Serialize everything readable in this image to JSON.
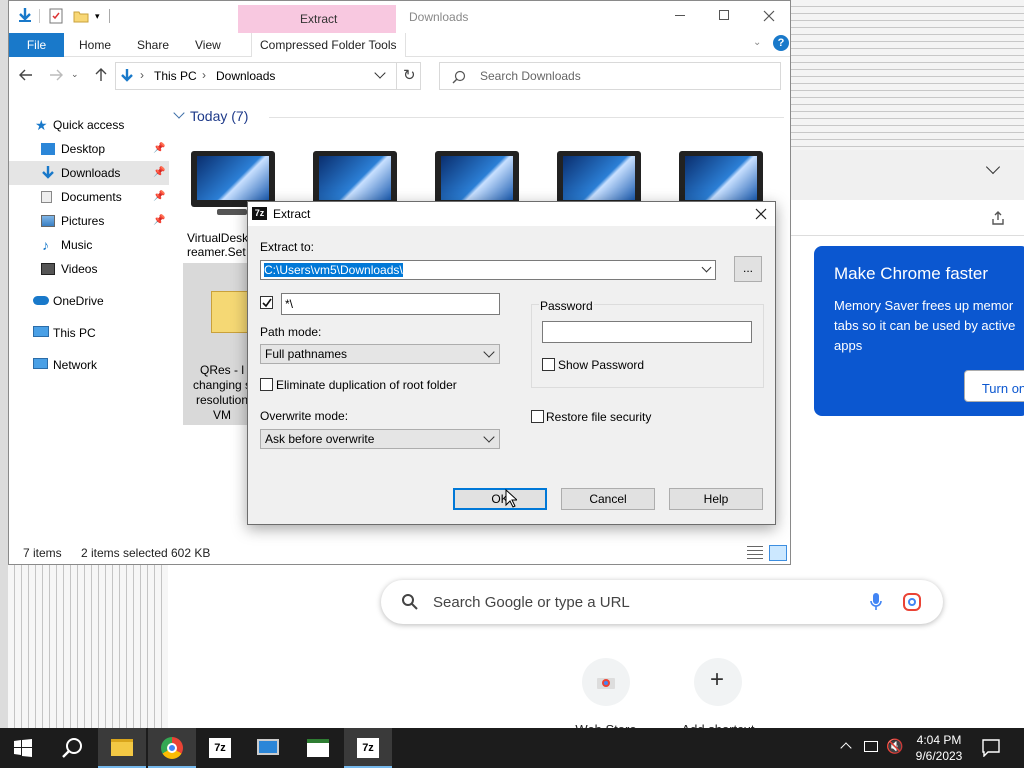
{
  "explorer": {
    "title": "Downloads",
    "ribbon_context_label": "Extract",
    "tabs": {
      "file": "File",
      "home": "Home",
      "share": "Share",
      "view": "View",
      "compressed": "Compressed Folder Tools"
    },
    "breadcrumb": {
      "root": "This PC",
      "folder": "Downloads"
    },
    "search_placeholder": "Search Downloads",
    "group_header": "Today (7)",
    "nav": {
      "quick_access": "Quick access",
      "desktop": "Desktop",
      "downloads": "Downloads",
      "documents": "Documents",
      "pictures": "Pictures",
      "music": "Music",
      "videos": "Videos",
      "onedrive": "OneDrive",
      "this_pc": "This PC",
      "network": "Network"
    },
    "files": [
      {
        "name": "VirtualDesk reamer.Set"
      },
      {
        "name": "QRes - l changing s resolution VM"
      }
    ],
    "status": {
      "items": "7 items",
      "selected": "2 items selected",
      "size": "602 KB"
    }
  },
  "dialog": {
    "title": "Extract",
    "extract_to_label": "Extract to:",
    "extract_to_value": "C:\\Users\\vm5\\Downloads\\",
    "browse_label": "...",
    "subfolder_value": "*\\",
    "path_mode_label": "Path mode:",
    "path_mode_value": "Full pathnames",
    "eliminate_label": "Eliminate duplication of root folder",
    "overwrite_label": "Overwrite mode:",
    "overwrite_value": "Ask before overwrite",
    "password_label": "Password",
    "show_password_label": "Show Password",
    "restore_security_label": "Restore file security",
    "ok": "OK",
    "cancel": "Cancel",
    "help": "Help"
  },
  "chrome": {
    "promo_title": "Make Chrome faster",
    "promo_text": "Memory Saver frees up memor tabs so it can be used by active apps",
    "promo_button": "Turn on",
    "search_placeholder": "Search Google or type a URL",
    "shortcut_web_store": "Web Store",
    "shortcut_add": "Add shortcut"
  },
  "taskbar": {
    "time": "4:04 PM",
    "date": "9/6/2023"
  }
}
